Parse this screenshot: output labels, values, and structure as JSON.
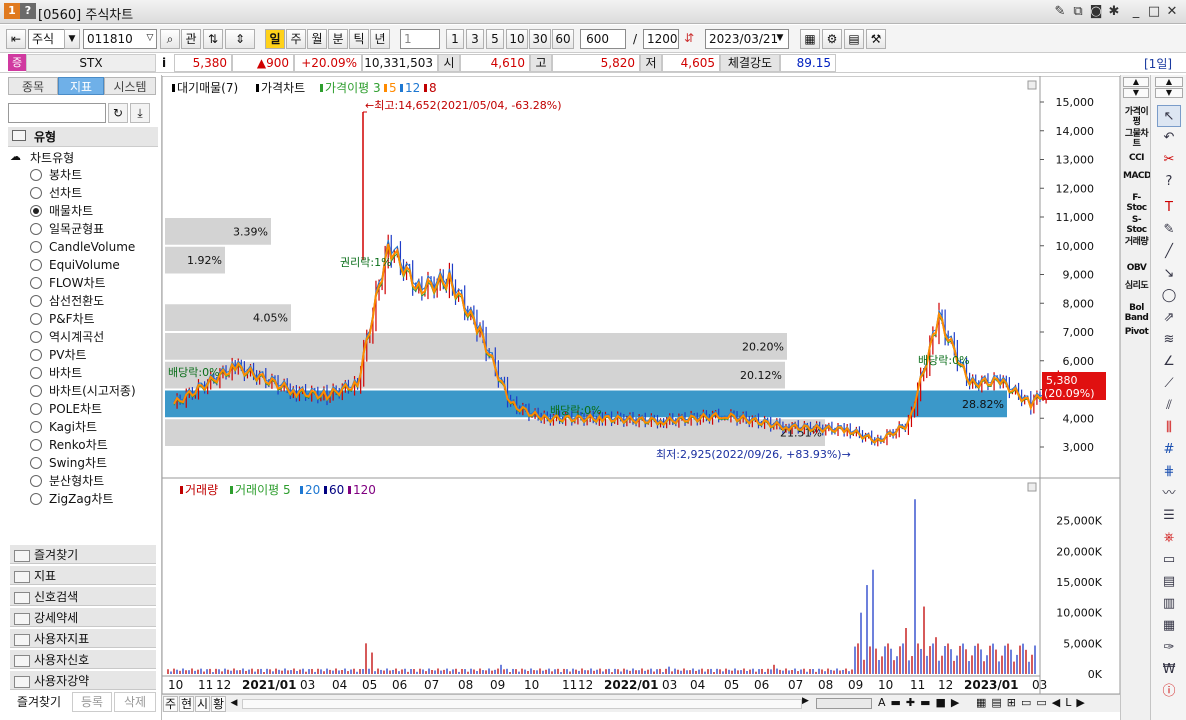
{
  "window": {
    "icon1": "1",
    "icon2": "?",
    "title": "[0560] 주식차트",
    "controls": [
      "_",
      "□",
      "✕"
    ]
  },
  "toolbar": {
    "market": "주식",
    "code": "011810",
    "btn_gwan": "관",
    "periods": [
      "일",
      "주",
      "월",
      "분",
      "틱",
      "년"
    ],
    "period_qty": "1",
    "quick": [
      "1",
      "3",
      "5",
      "10",
      "30",
      "60"
    ],
    "count": "600",
    "total": "1200",
    "date": "2023/03/21"
  },
  "quote": {
    "badge": "증",
    "name": "STX",
    "info": "i",
    "price": "5,380",
    "change": "▲900",
    "rate": "+20.09%",
    "volume": "10,331,503",
    "open_label": "시",
    "open": "4,610",
    "high_label": "고",
    "high": "5,820",
    "low_label": "저",
    "low": "4,605",
    "strength_label": "체결강도",
    "strength": "89.15",
    "period_badge": "[1일]"
  },
  "left": {
    "tabs": [
      "종목",
      "지표",
      "시스템"
    ],
    "section": "유형",
    "group": "차트유형",
    "items": [
      "봉차트",
      "선차트",
      "매물차트",
      "일목균형표",
      "CandleVolume",
      "EquiVolume",
      "FLOW차트",
      "삼선전환도",
      "P&F차트",
      "역시계곡선",
      "PV차트",
      "바차트",
      "바차트(시고저종)",
      "POLE차트",
      "Kagi차트",
      "Renko차트",
      "Swing차트",
      "분산형차트",
      "ZigZag차트"
    ],
    "selected": 2,
    "folders": [
      "즐겨찾기",
      "지표",
      "신호검색",
      "강세약세",
      "사용자지표",
      "사용자신호",
      "사용자강약"
    ],
    "footer": [
      "즐겨찾기",
      "등록",
      "삭제"
    ]
  },
  "chart_data": [
    {
      "type": "candlestick",
      "title": "",
      "legend": [
        {
          "label": "대기매물(7)",
          "color": "#000000"
        },
        {
          "label": "가격차트",
          "color": "#000000"
        },
        {
          "label": "가격이평 3",
          "color": "#2e9e2e"
        },
        {
          "label": "5",
          "color": "#ff8a00"
        },
        {
          "label": "12",
          "color": "#1e78d2"
        },
        {
          "label": "8",
          "color": "#c00000"
        }
      ],
      "yticks": [
        "15,000",
        "14,000",
        "13,000",
        "12,000",
        "11,000",
        "10,000",
        "9,000",
        "8,000",
        "7,000",
        "6,000",
        "5,000",
        "4,000",
        "3,000"
      ],
      "ylim": [
        2500,
        15500
      ],
      "current_price": "5,380",
      "current_rate": "(20.09%)",
      "high_note": "←최고:14,652(2021/05/04, -63.28%)",
      "low_note": "최저:2,925(2022/09/26, +83.93%)→",
      "volume_profile": [
        {
          "range": [
            3000,
            4000
          ],
          "pct": "21.51%"
        },
        {
          "range": [
            4000,
            5000
          ],
          "pct": "28.82%"
        },
        {
          "range": [
            5000,
            6000
          ],
          "pct": "20.12%"
        },
        {
          "range": [
            6000,
            7000
          ],
          "pct": "20.20%"
        },
        {
          "range": [
            7000,
            8000
          ],
          "pct": "4.05%"
        },
        {
          "range": [
            9000,
            10000
          ],
          "pct": "1.92%"
        },
        {
          "range": [
            10000,
            11000
          ],
          "pct": "3.39%"
        }
      ],
      "annotations": [
        "배당락:0%",
        "권리락:1%",
        "배당락:0%",
        "배당락:0%"
      ],
      "series": [
        {
          "x": [
            "2020/10",
            "2020/12",
            "2021/02",
            "2021/03",
            "2021/04",
            "2021/05",
            "2021/06",
            "2021/07",
            "2021/08",
            "2021/09",
            "2021/10",
            "2021/12",
            "2022/02",
            "2022/04",
            "2022/06",
            "2022/08",
            "2022/09",
            "2022/10",
            "2022/11",
            "2022/12",
            "2023/01",
            "2023/02",
            "2023/03"
          ],
          "values": [
            4500,
            5800,
            4900,
            4800,
            5200,
            10000,
            8500,
            8800,
            7000,
            4500,
            4000,
            4000,
            3900,
            4100,
            3700,
            3600,
            3200,
            3800,
            7500,
            5200,
            5300,
            4500,
            5380
          ]
        }
      ]
    },
    {
      "type": "bar",
      "title": "",
      "legend": [
        {
          "label": "거래량",
          "color": "#c00000"
        },
        {
          "label": "거래이평 5",
          "color": "#2e9e2e"
        },
        {
          "label": "20",
          "color": "#1e78d2"
        },
        {
          "label": "60",
          "color": "#000080"
        },
        {
          "label": "120",
          "color": "#800080"
        }
      ],
      "yticks": [
        "25,000K",
        "20,000K",
        "15,000K",
        "10,000K",
        "5,000K",
        "0K"
      ],
      "ylim": [
        0,
        30000
      ],
      "x_ticks": [
        "10",
        "11",
        "12",
        "2021/01",
        "03",
        "04",
        "05",
        "06",
        "07",
        "08",
        "09",
        "10",
        "11",
        "12",
        "2022/01",
        "03",
        "04",
        "05",
        "06",
        "07",
        "08",
        "09",
        "10",
        "11",
        "12",
        "2023/01",
        "03"
      ]
    }
  ],
  "bottom": {
    "tabs": [
      "주",
      "현",
      "시",
      "황"
    ]
  },
  "right_indicators": [
    "가격이평",
    "그물차트",
    "CCI",
    "MACD",
    "F-Stoc",
    "S-Stoc",
    "거래량",
    "OBV",
    "심리도",
    "Bol Band",
    "Pivot"
  ]
}
